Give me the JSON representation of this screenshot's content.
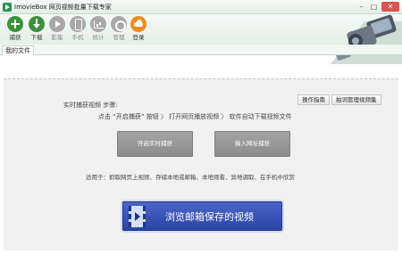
{
  "window": {
    "title": "ImovieBox 网页视频批量下载专家",
    "minimize": "–",
    "maximize": "□",
    "close": "✕"
  },
  "toolbar": {
    "items": [
      {
        "label": "捕获",
        "icon": "plus-icon",
        "state": "active"
      },
      {
        "label": "下载",
        "icon": "download-icon",
        "state": "active"
      },
      {
        "label": "影集",
        "icon": "play-icon",
        "state": "disabled"
      },
      {
        "label": "手机",
        "icon": "phone-icon",
        "state": "disabled"
      },
      {
        "label": "统计",
        "icon": "chart-icon",
        "state": "disabled"
      },
      {
        "label": "管理",
        "icon": "gear-icon",
        "state": "disabled"
      },
      {
        "label": "登录",
        "icon": "cloud-icon",
        "state": "orange"
      }
    ]
  },
  "tabs": {
    "my_files": "我的文件"
  },
  "help": {
    "guide": "操作指南",
    "manage": "拍词管理视频集"
  },
  "steps": {
    "title": "实时捕获视频 步骤:",
    "line": "点击 “开启捕获” 按钮  〉 打开网页播放视频  〉 软件自动下载视频文件"
  },
  "buttons": {
    "start_capture": "开启实时捕获",
    "url_capture": "输入网址捕获",
    "browse_mail": "浏览邮箱保存的视频"
  },
  "usage": "适用于：抓取网页上视频、存储本地或邮箱、本地观看、异地调取、在手机中欣赏",
  "colors": {
    "active_green": "#3d8f3d",
    "disabled_gray": "#a8a8a8",
    "login_orange": "#f28a1e",
    "big_button_blue": "#2a44a6",
    "close_red": "#d9534f"
  }
}
